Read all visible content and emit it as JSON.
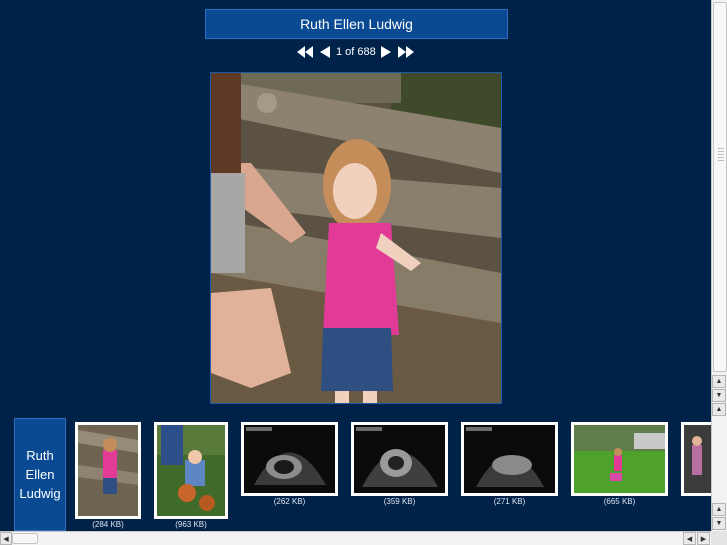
{
  "album": {
    "title": "Ruth Ellen Ludwig",
    "sidebar_label": "Ruth Ellen Ludwig"
  },
  "navigation": {
    "counter": "1 of 688",
    "first_icon": "rewind-icon",
    "prev_icon": "triangle-left-icon",
    "next_icon": "triangle-right-icon",
    "last_icon": "fast-forward-icon"
  },
  "main_photo": {
    "icon": "photo-image"
  },
  "thumbnails": [
    {
      "size": "(284 KB)"
    },
    {
      "size": "(963 KB)"
    },
    {
      "size": "(262 KB)"
    },
    {
      "size": "(359 KB)"
    },
    {
      "size": "(271 KB)"
    },
    {
      "size": "(665 KB)"
    },
    {
      "size": ""
    }
  ],
  "scrollbars": {
    "up_arrow": "▲",
    "down_arrow": "▼",
    "left_arrow": "◀",
    "right_arrow": "▶"
  },
  "colors": {
    "background": "#002249",
    "accent": "#0a4a93",
    "border": "#2f6fc0"
  }
}
